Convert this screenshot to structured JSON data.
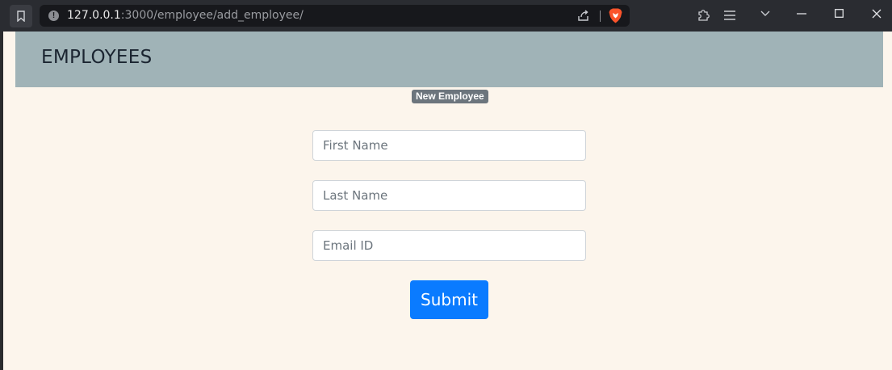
{
  "browser": {
    "url_host": "127.0.0.1",
    "url_path": ":3000/employee/add_employee/"
  },
  "page": {
    "header_title": "EMPLOYEES",
    "badge": "New Employee",
    "form": {
      "first_name_placeholder": "First Name",
      "last_name_placeholder": "Last Name",
      "email_placeholder": "Email ID",
      "submit_label": "Submit"
    }
  },
  "colors": {
    "header_bg": "#a0b3b7",
    "page_bg": "#fcf5ec",
    "submit_bg": "#0a7bff",
    "badge_bg": "#6c757d"
  },
  "icons": [
    "bookmark-icon",
    "info-icon",
    "share-icon",
    "brave-lion-icon",
    "extensions-icon",
    "menu-icon",
    "chevron-down-icon",
    "minimize-icon",
    "maximize-icon",
    "close-icon"
  ]
}
